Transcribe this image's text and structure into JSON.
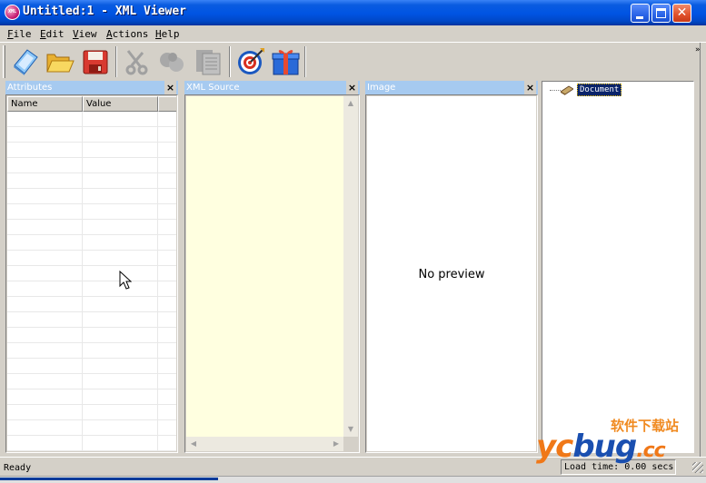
{
  "window": {
    "title": "Untitled:1 - XML Viewer",
    "app_icon_text": "XML",
    "minimize_glyph": "",
    "close_glyph": "✕"
  },
  "menu": [
    {
      "label": "File",
      "accel": "F",
      "rest": "ile"
    },
    {
      "label": "Edit",
      "accel": "E",
      "rest": "dit"
    },
    {
      "label": "View",
      "accel": "V",
      "rest": "iew"
    },
    {
      "label": "Actions",
      "accel": "A",
      "rest": "ctions"
    },
    {
      "label": "Help",
      "accel": "H",
      "rest": "elp"
    }
  ],
  "toolbar": {
    "buttons": [
      {
        "name": "new-icon",
        "enabled": true
      },
      {
        "name": "open-folder-icon",
        "enabled": true
      },
      {
        "name": "save-icon",
        "enabled": true
      },
      {
        "name": "cut-icon",
        "enabled": false
      },
      {
        "name": "copy-icon",
        "enabled": false
      },
      {
        "name": "paste-icon",
        "enabled": false
      },
      {
        "name": "target-icon",
        "enabled": true
      },
      {
        "name": "gift-icon",
        "enabled": true
      }
    ],
    "overflow": "»"
  },
  "panels": {
    "attributes": {
      "title": "Attributes",
      "close": "×",
      "columns": [
        "Name",
        "Value"
      ]
    },
    "xml_source": {
      "title": "XML Source",
      "close": "×"
    },
    "image": {
      "title": "Image",
      "close": "×",
      "empty_text": "No preview"
    }
  },
  "tree": {
    "root_label": "Document"
  },
  "status": {
    "text": "Ready",
    "load_time": "Load time: 0.00 secs"
  },
  "watermark": {
    "cn": "软件下载站",
    "brand_a": "yc",
    "brand_b": "bug",
    "tld": ".cc"
  },
  "colors": {
    "titlebar": "#0054e3",
    "panel_header": "#a6caf0",
    "xml_bg": "#ffffe0",
    "selection": "#0a246a",
    "watermark_orange": "#f07818",
    "watermark_blue": "#1a4fb0"
  }
}
